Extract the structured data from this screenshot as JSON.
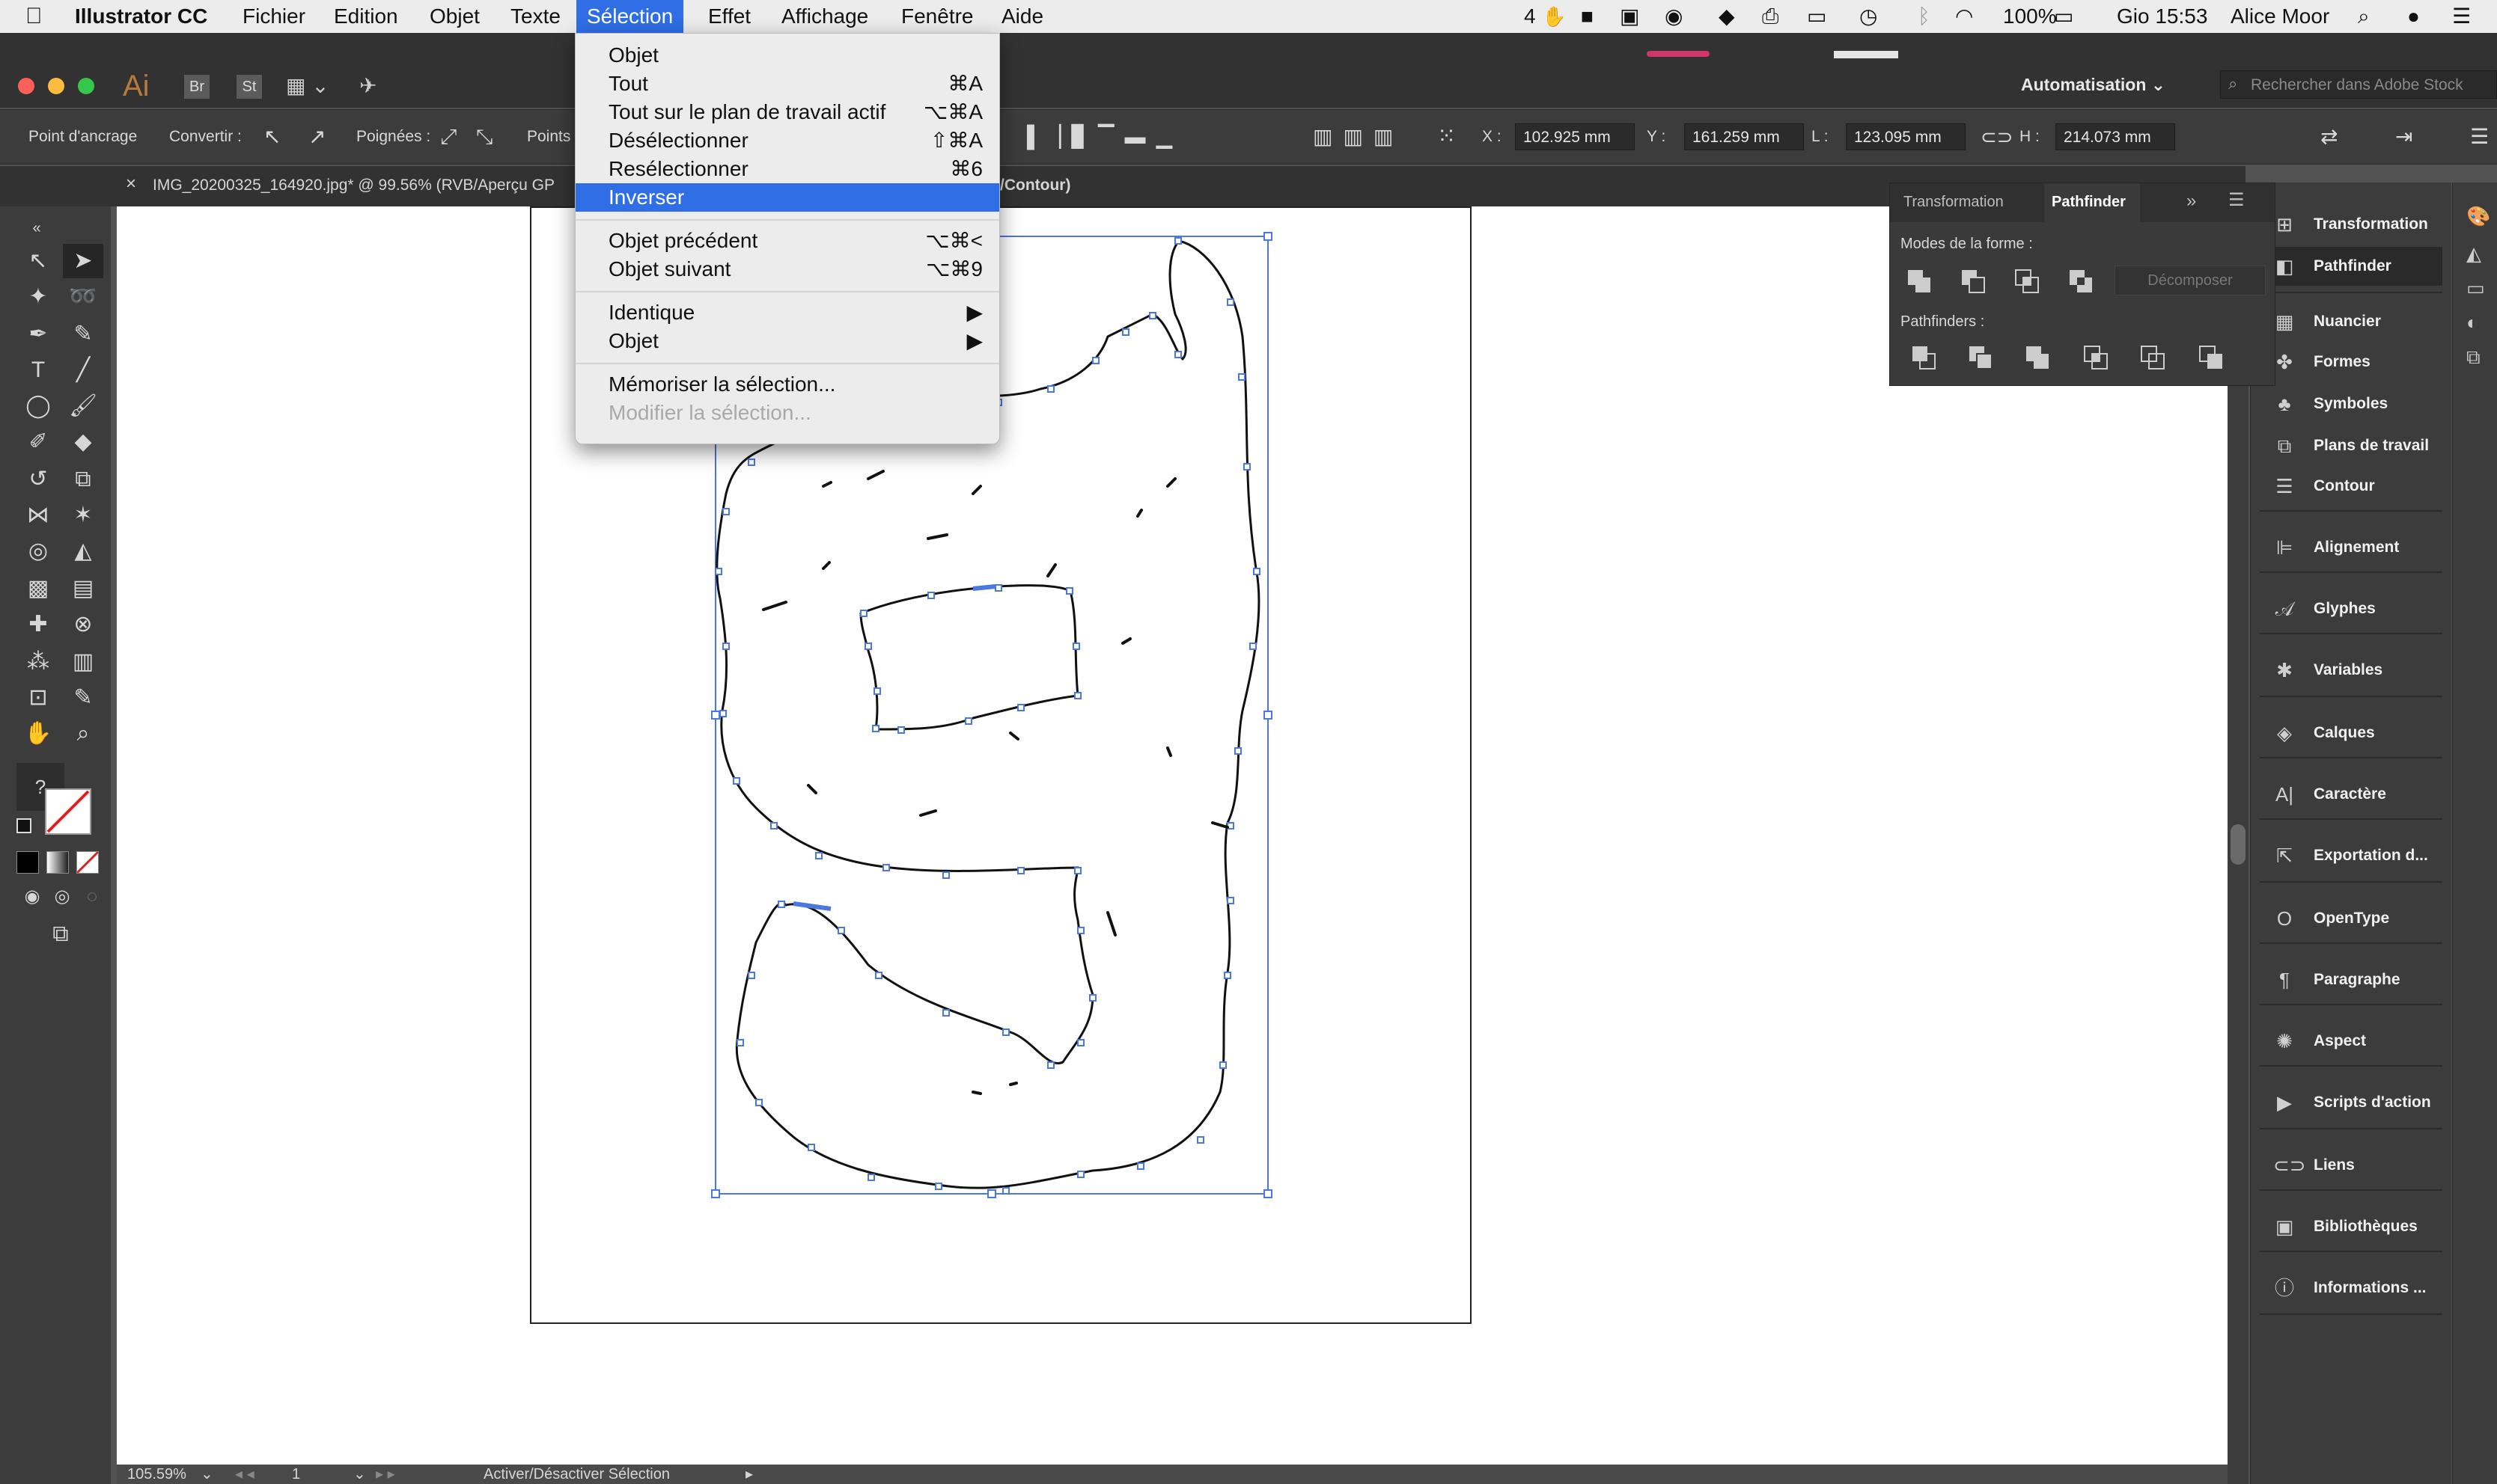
{
  "menubar": {
    "app_name": "Illustrator CC",
    "items": [
      "Fichier",
      "Edition",
      "Objet",
      "Texte",
      "Sélection",
      "Effet",
      "Affichage",
      "Fenêtre",
      "Aide"
    ],
    "status": {
      "badge": "4",
      "battery": "100%",
      "clock": "Gio 15:53",
      "user": "Alice Moor"
    }
  },
  "appbar": {
    "logo": "Ai",
    "bridge": "Br",
    "stock": "St",
    "workspace": "Automatisation",
    "search_placeholder": "Rechercher dans Adobe Stock"
  },
  "control_bar": {
    "anchor_label": "Point d'ancrage",
    "convert_label": "Convertir :",
    "handles_label": "Poignées :",
    "points_label": "Points",
    "x_label": "X :",
    "x_value": "102.925 mm",
    "y_label": "Y :",
    "y_value": "161.259 mm",
    "w_label": "L :",
    "w_value": "123.095 mm",
    "h_label": "H :",
    "h_value": "214.073 mm"
  },
  "document_tab": {
    "title": "IMG_20200325_164920.jpg* @ 99.56% (RVB/Aperçu GP",
    "title_tail": "/Contour)"
  },
  "selection_menu": {
    "rows": [
      {
        "label": "Objet",
        "shortcut": ""
      },
      {
        "label": "Tout",
        "shortcut": "⌘A"
      },
      {
        "label": "Tout sur le plan de travail actif",
        "shortcut": "⌥⌘A"
      },
      {
        "label": "Désélectionner",
        "shortcut": "⇧⌘A"
      },
      {
        "label": "Resélectionner",
        "shortcut": "⌘6"
      },
      {
        "label": "Inverser",
        "shortcut": ""
      },
      {
        "label": "Objet précédent",
        "shortcut": "⌥⌘<"
      },
      {
        "label": "Objet suivant",
        "shortcut": "⌥⌘9"
      },
      {
        "label": "Identique",
        "shortcut": "▶"
      },
      {
        "label": "Objet",
        "shortcut": "▶"
      },
      {
        "label": "Mémoriser la sélection...",
        "shortcut": ""
      },
      {
        "label": "Modifier la sélection...",
        "shortcut": ""
      }
    ]
  },
  "pathfinder_panel": {
    "tab_transformation": "Transformation",
    "tab_pathfinder": "Pathfinder",
    "shape_modes_label": "Modes de la forme :",
    "expand_label": "Décomposer",
    "pathfinders_label": "Pathfinders :"
  },
  "dock": {
    "items": [
      {
        "label": "Transformation",
        "icon": "transform-icon"
      },
      {
        "label": "Pathfinder",
        "icon": "pathfinder-icon"
      },
      {
        "label": "Nuancier",
        "icon": "swatches-icon"
      },
      {
        "label": "Formes",
        "icon": "brushes-icon"
      },
      {
        "label": "Symboles",
        "icon": "symbols-icon"
      },
      {
        "label": "Plans de travail",
        "icon": "artboards-icon"
      },
      {
        "label": "Contour",
        "icon": "stroke-icon"
      },
      {
        "label": "Alignement",
        "icon": "align-icon"
      },
      {
        "label": "Glyphes",
        "icon": "glyphs-icon"
      },
      {
        "label": "Variables",
        "icon": "variables-icon"
      },
      {
        "label": "Calques",
        "icon": "layers-icon"
      },
      {
        "label": "Caractère",
        "icon": "character-icon"
      },
      {
        "label": "Exportation d...",
        "icon": "export-icon"
      },
      {
        "label": "OpenType",
        "icon": "opentype-icon"
      },
      {
        "label": "Paragraphe",
        "icon": "paragraph-icon"
      },
      {
        "label": "Aspect",
        "icon": "appearance-icon"
      },
      {
        "label": "Scripts d'action",
        "icon": "actions-icon"
      },
      {
        "label": "Liens",
        "icon": "links-icon"
      },
      {
        "label": "Bibliothèques",
        "icon": "libraries-icon"
      },
      {
        "label": "Informations ...",
        "icon": "info-icon"
      }
    ]
  },
  "status_bar": {
    "zoom": "105.59%",
    "artboard_number": "1",
    "status_text": "Activer/Désactiver Sélection"
  },
  "colors": {
    "accent": "#2f6ee5",
    "selection_blue": "#4a78e0",
    "ui_dark": "#535353",
    "panel": "#3c3c3c"
  }
}
